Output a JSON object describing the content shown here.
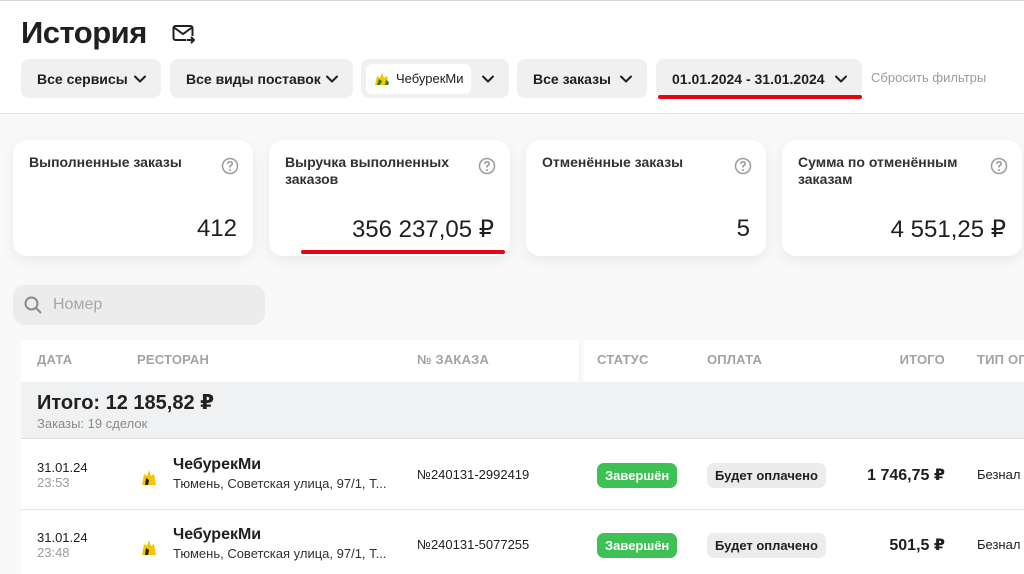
{
  "header": {
    "title": "История",
    "filters": {
      "services": "Все сервисы",
      "delivery": "Все виды поставок",
      "brand": "ЧебурекМи",
      "orders": "Все заказы",
      "dates": "01.01.2024 - 31.01.2024"
    },
    "reset_label": "Сбросить фильтры"
  },
  "cards": [
    {
      "label": "Выполненные заказы",
      "value": "412"
    },
    {
      "label": "Выручка выполненных заказов",
      "value": "356 237,05 ₽"
    },
    {
      "label": "Отменённые заказы",
      "value": "5"
    },
    {
      "label": "Сумма по отменённым заказам",
      "value": "4 551,25 ₽"
    }
  ],
  "search": {
    "placeholder": "Номер"
  },
  "table": {
    "columns": {
      "date": "ДАТА",
      "restaurant": "РЕСТОРАН",
      "order_number": "№ ЗАКАЗА",
      "status": "СТАТУС",
      "payment": "ОПЛАТА",
      "total": "ИТОГО",
      "payment_type": "ТИП ОП"
    },
    "summary": {
      "title": "Итого: 12 185,82 ₽",
      "subtitle": "Заказы: 19 сделок"
    },
    "rows": [
      {
        "date": "31.01.24",
        "time": "23:53",
        "name": "ЧебурекМи",
        "address": "Тюмень, Советская улица, 97/1, Т...",
        "order": "№240131-2992419",
        "status": "Завершён",
        "payment": "Будет оплачено",
        "total": "1 746,75 ₽",
        "payment_type": "Безнал"
      },
      {
        "date": "31.01.24",
        "time": "23:48",
        "name": "ЧебурекМи",
        "address": "Тюмень, Советская улица, 97/1, Т...",
        "order": "№240131-5077255",
        "status": "Завершён",
        "payment": "Будет оплачено",
        "total": "501,5 ₽",
        "payment_type": "Безнал"
      }
    ]
  },
  "colors": {
    "accent_underline": "#e30613",
    "status_done": "#3ec154",
    "chip_bg": "#f0f0f0"
  }
}
